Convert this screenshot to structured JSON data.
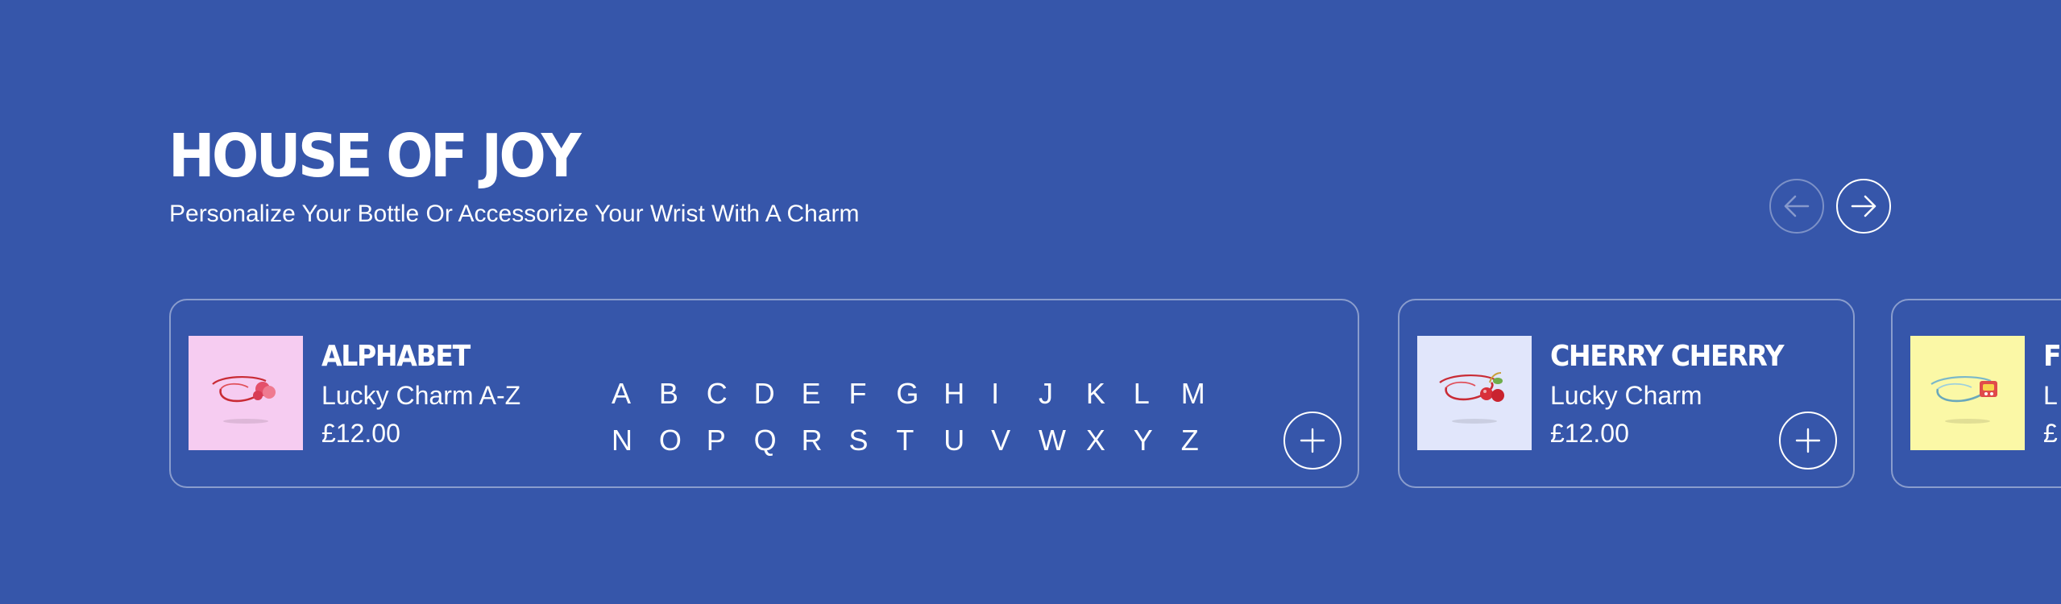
{
  "section": {
    "title": "HOUSE OF JOY",
    "subtitle": "Personalize Your Bottle Or Accessorize Your Wrist With A Charm"
  },
  "nav": {
    "prev_icon": "arrow-left-icon",
    "next_icon": "arrow-right-icon"
  },
  "products": [
    {
      "name": "ALPHABET",
      "subtitle": "Lucky Charm A-Z",
      "price": "£12.00",
      "thumb_bg": "#f6ccf1",
      "letters_row1": [
        "A",
        "B",
        "C",
        "D",
        "E",
        "F",
        "G",
        "H",
        "I",
        "J",
        "K",
        "L",
        "M"
      ],
      "letters_row2": [
        "N",
        "O",
        "P",
        "Q",
        "R",
        "S",
        "T",
        "U",
        "V",
        "W",
        "X",
        "Y",
        "Z"
      ]
    },
    {
      "name": "CHERRY CHERRY",
      "subtitle": "Lucky Charm",
      "price": "£12.00",
      "thumb_bg": "#e1e6fb"
    },
    {
      "name": "F",
      "subtitle": "L",
      "price": "£",
      "thumb_bg": "#fbf8a6"
    }
  ],
  "colors": {
    "background": "#3656aa",
    "text": "#ffffff",
    "charm_red": "#d8343c"
  }
}
